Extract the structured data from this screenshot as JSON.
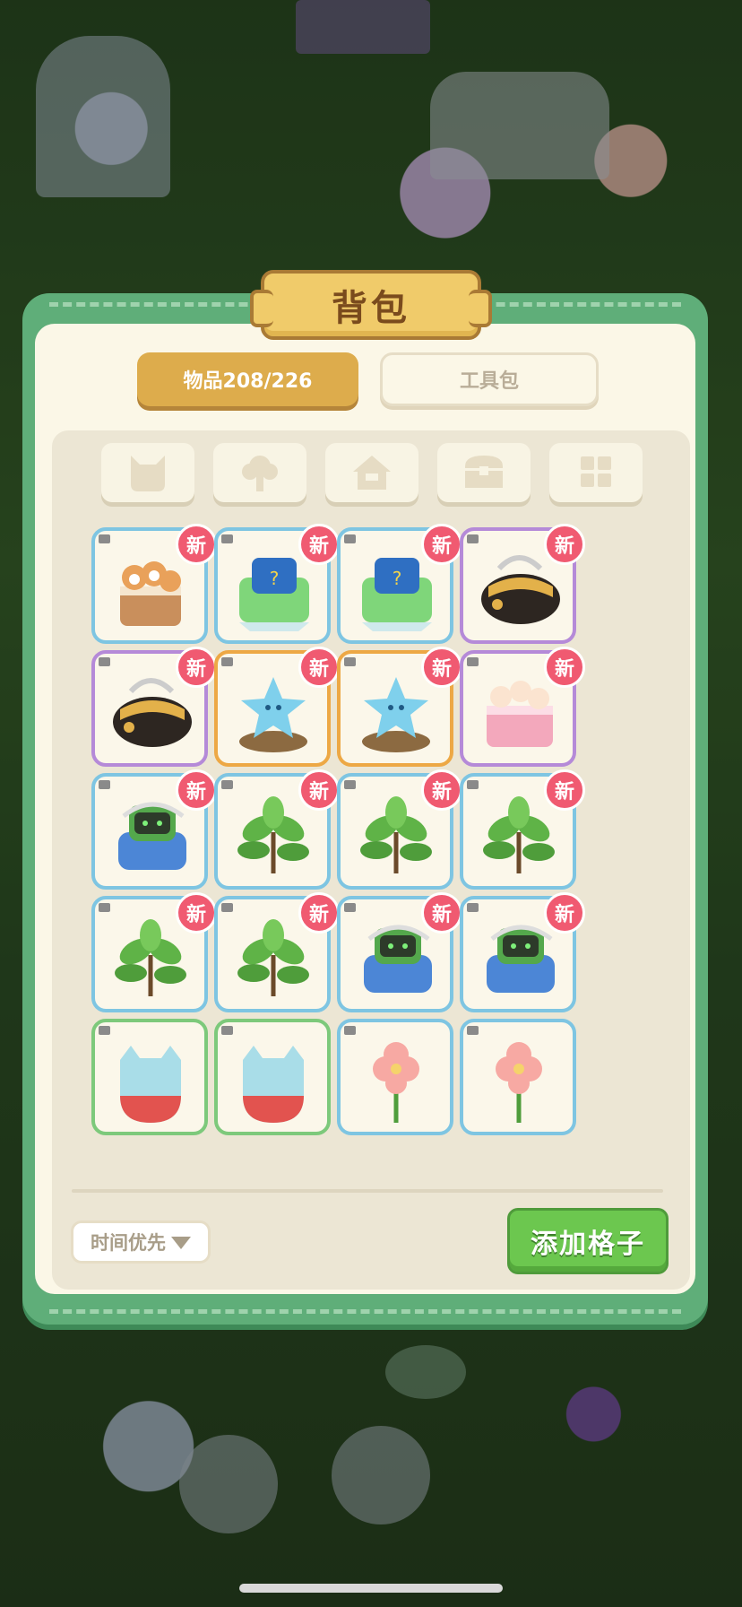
{
  "title": "背包",
  "tabs": {
    "items": "物品208/226",
    "tools": "工具包"
  },
  "categories": [
    "cat-icon",
    "tree-icon",
    "house-icon",
    "chest-icon",
    "grid-icon"
  ],
  "new_badge": "新",
  "items": [
    {
      "name": "shiba-cake",
      "rarity": "blue",
      "new": true
    },
    {
      "name": "mystery-box-green",
      "rarity": "blue",
      "new": true
    },
    {
      "name": "mystery-box-green",
      "rarity": "blue",
      "new": true
    },
    {
      "name": "black-gold-bag",
      "rarity": "purple",
      "new": true
    },
    {
      "name": "black-gold-bag",
      "rarity": "purple",
      "new": true
    },
    {
      "name": "star-sprout",
      "rarity": "orange",
      "new": true
    },
    {
      "name": "star-sprout",
      "rarity": "orange",
      "new": true
    },
    {
      "name": "pink-cake",
      "rarity": "purple",
      "new": true
    },
    {
      "name": "robot-bag",
      "rarity": "blue",
      "new": true
    },
    {
      "name": "leaf-plant",
      "rarity": "blue",
      "new": true
    },
    {
      "name": "leaf-plant",
      "rarity": "blue",
      "new": true
    },
    {
      "name": "leaf-plant",
      "rarity": "blue",
      "new": true
    },
    {
      "name": "leaf-plant",
      "rarity": "blue",
      "new": true
    },
    {
      "name": "leaf-plant",
      "rarity": "blue",
      "new": true
    },
    {
      "name": "robot-bag",
      "rarity": "blue",
      "new": true
    },
    {
      "name": "robot-bag",
      "rarity": "blue",
      "new": true
    },
    {
      "name": "cat-potion",
      "rarity": "green",
      "new": false
    },
    {
      "name": "cat-potion",
      "rarity": "green",
      "new": false
    },
    {
      "name": "pink-flower",
      "rarity": "blue",
      "new": false
    },
    {
      "name": "pink-flower",
      "rarity": "blue",
      "new": false
    }
  ],
  "sort": {
    "label": "时间优先"
  },
  "add_button": "添加格子",
  "colors": {
    "panel_green": "#5fae79",
    "tab_active": "#ddac4c",
    "rarity_blue": "#7ec5e2",
    "rarity_purple": "#b58ad8",
    "rarity_orange": "#eda845",
    "rarity_green": "#7dc97b",
    "badge": "#f05a71",
    "add_button": "#6cc74f"
  }
}
